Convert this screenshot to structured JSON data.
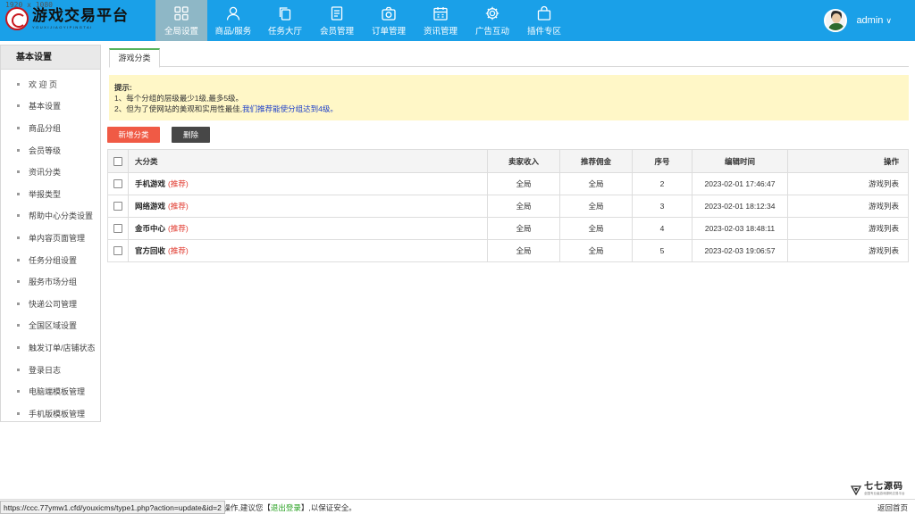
{
  "screen_label": "1920 x 1080",
  "logo": {
    "title": "游戏交易平台",
    "subtitle": "YOUXIJIAOYIPINGTAI"
  },
  "nav": [
    {
      "label": "全局设置",
      "icon": "grid-icon",
      "active": true
    },
    {
      "label": "商品/服务",
      "icon": "user-icon"
    },
    {
      "label": "任务大厅",
      "icon": "copy-icon"
    },
    {
      "label": "会员管理",
      "icon": "document-icon"
    },
    {
      "label": "订单管理",
      "icon": "camera-icon"
    },
    {
      "label": "资讯管理",
      "icon": "calendar-icon"
    },
    {
      "label": "广告互动",
      "icon": "gear-icon"
    },
    {
      "label": "插件专区",
      "icon": "bag-icon"
    }
  ],
  "user": {
    "name": "admin",
    "caret": "∨"
  },
  "sidebar": {
    "title": "基本设置",
    "items": [
      "欢 迎 页",
      "基本设置",
      "商品分组",
      "会员等级",
      "资讯分类",
      "举报类型",
      "帮助中心分类设置",
      "单内容页面管理",
      "任务分组设置",
      "服务市场分组",
      "快递公司管理",
      "全国区域设置",
      "触发订单/店铺状态",
      "登录日志",
      "电脑端模板管理",
      "手机版模板管理"
    ]
  },
  "tab": {
    "label": "游戏分类"
  },
  "notice": {
    "title": "提示:",
    "line1": "1、每个分组的层级最少1级,最多5级。",
    "line2_prefix": "2、但为了使网站的美观和实用性最佳,",
    "line2_link": "我们推荐能使分组达到4级。"
  },
  "buttons": {
    "add": "新增分类",
    "delete": "删除"
  },
  "table": {
    "headers": {
      "name": "大分类",
      "seller": "卖家收入",
      "commission": "推荐佣金",
      "seq": "序号",
      "time": "编辑时间",
      "op": "操作"
    },
    "rows": [
      {
        "name": "手机游戏",
        "tag": "(推荐)",
        "seller": "全局",
        "commission": "全局",
        "seq": "2",
        "time": "2023-02-01 17:46:47",
        "op": "游戏列表"
      },
      {
        "name": "网络游戏",
        "tag": "(推荐)",
        "seller": "全局",
        "commission": "全局",
        "seq": "3",
        "time": "2023-02-01 18:12:34",
        "op": "游戏列表"
      },
      {
        "name": "金币中心",
        "tag": "(推荐)",
        "seller": "全局",
        "commission": "全局",
        "seq": "4",
        "time": "2023-02-03 18:48:11",
        "op": "游戏列表"
      },
      {
        "name": "官方回收",
        "tag": "(推荐)",
        "seller": "全局",
        "commission": "全局",
        "seq": "5",
        "time": "2023-02-03 19:06:57",
        "op": "游戏列表"
      }
    ]
  },
  "status": {
    "prefix": "不操作,建议您【",
    "link": "退出登录",
    "suffix": "】,以保证安全。",
    "back_home": "返回首页",
    "url_tip": "https://ccc.77ymw1.cfd/youxicms/type1.php?action=update&id=2"
  },
  "watermark": {
    "title": "七七源码",
    "subtitle": "全国专业级游戏源码交易平台"
  },
  "colors": {
    "topbar": "#1aa0e8",
    "nav_active": "#8eb7c6",
    "add_button": "#f05a45",
    "delete_button": "#474747",
    "notice_bg": "#fff7c7",
    "recommend": "#e0372c"
  }
}
